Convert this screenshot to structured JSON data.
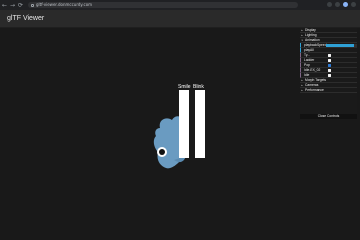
{
  "browser": {
    "url": "gltf-viewer.donmccurdy.com",
    "nav": [
      "←",
      "→",
      "⟳"
    ]
  },
  "app": {
    "title": "glTF Viewer"
  },
  "viewport": {
    "morph_labels": [
      "Smile",
      "Blink"
    ]
  },
  "gui": {
    "folders": [
      "Display",
      "Lighting",
      "Animation"
    ],
    "controls": [
      {
        "label": "playbackSpeed",
        "type": "slider",
        "value": 1.0
      },
      {
        "label": "playAll",
        "type": "label"
      },
      {
        "label": "Ty...",
        "type": "checkbox",
        "checked": false
      },
      {
        "label": "Ladder",
        "type": "checkbox",
        "checked": false
      },
      {
        "label": "Pop",
        "type": "checkbox",
        "checked": true
      },
      {
        "label": "Idle-EX_02",
        "type": "checkbox",
        "checked": false
      },
      {
        "label": "Idle",
        "type": "checkbox",
        "checked": false
      }
    ],
    "bottom_folders": [
      "Morph Targets",
      "Cameras",
      "Performance"
    ],
    "close_label": "Close Controls"
  },
  "colors": {
    "accent": "#2fa1d6",
    "model_body": "#6a9bc1",
    "background": "#191919"
  }
}
